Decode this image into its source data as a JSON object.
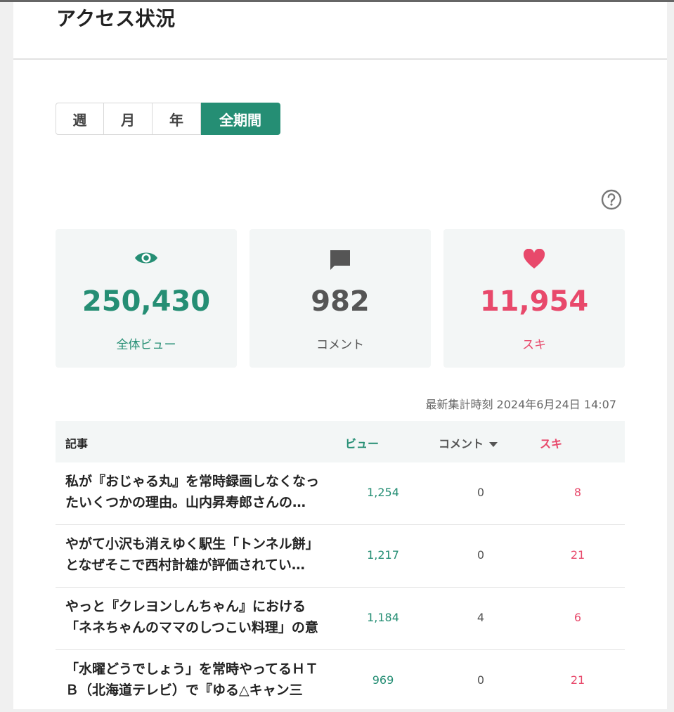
{
  "page": {
    "title": "アクセス状況"
  },
  "period_tabs": [
    {
      "label": "週",
      "active": false
    },
    {
      "label": "月",
      "active": false
    },
    {
      "label": "年",
      "active": false
    },
    {
      "label": "全期間",
      "active": true
    }
  ],
  "help": {
    "icon": "question-circle-icon"
  },
  "stats": {
    "views": {
      "value": "250,430",
      "label": "全体ビュー",
      "icon": "eye-icon",
      "color": "#258e74"
    },
    "comments": {
      "value": "982",
      "label": "コメント",
      "icon": "comment-icon",
      "color": "#555555"
    },
    "likes": {
      "value": "11,954",
      "label": "スキ",
      "icon": "heart-icon",
      "color": "#e8496b"
    }
  },
  "updated": "最新集計時刻 2024年6月24日 14:07",
  "table": {
    "headers": {
      "article": "記事",
      "views": "ビュー",
      "comments": "コメント",
      "likes": "スキ"
    },
    "rows": [
      {
        "title": "私が『おじゃる丸』を常時録画しなくなったいくつかの理由。山内昇寿郎さんの…",
        "views": "1,254",
        "comments": "0",
        "likes": "8"
      },
      {
        "title": "やがて小沢も消えゆく駅生「トンネル餅」となぜそこで西村計雄が評価されてい…",
        "views": "1,217",
        "comments": "0",
        "likes": "21"
      },
      {
        "title": "やっと『クレヨンしんちゃん』における「ネネちゃんのママのしつこい料理」の意味…",
        "views": "1,184",
        "comments": "4",
        "likes": "6"
      },
      {
        "title": "「水曜どうでしょう」を常時やってるＨＴＢ（北海道テレビ）で『ゆる△キャン三期』…",
        "views": "969",
        "comments": "0",
        "likes": "21"
      }
    ]
  },
  "colors": {
    "accent": "#258e74",
    "like": "#e8496b"
  }
}
